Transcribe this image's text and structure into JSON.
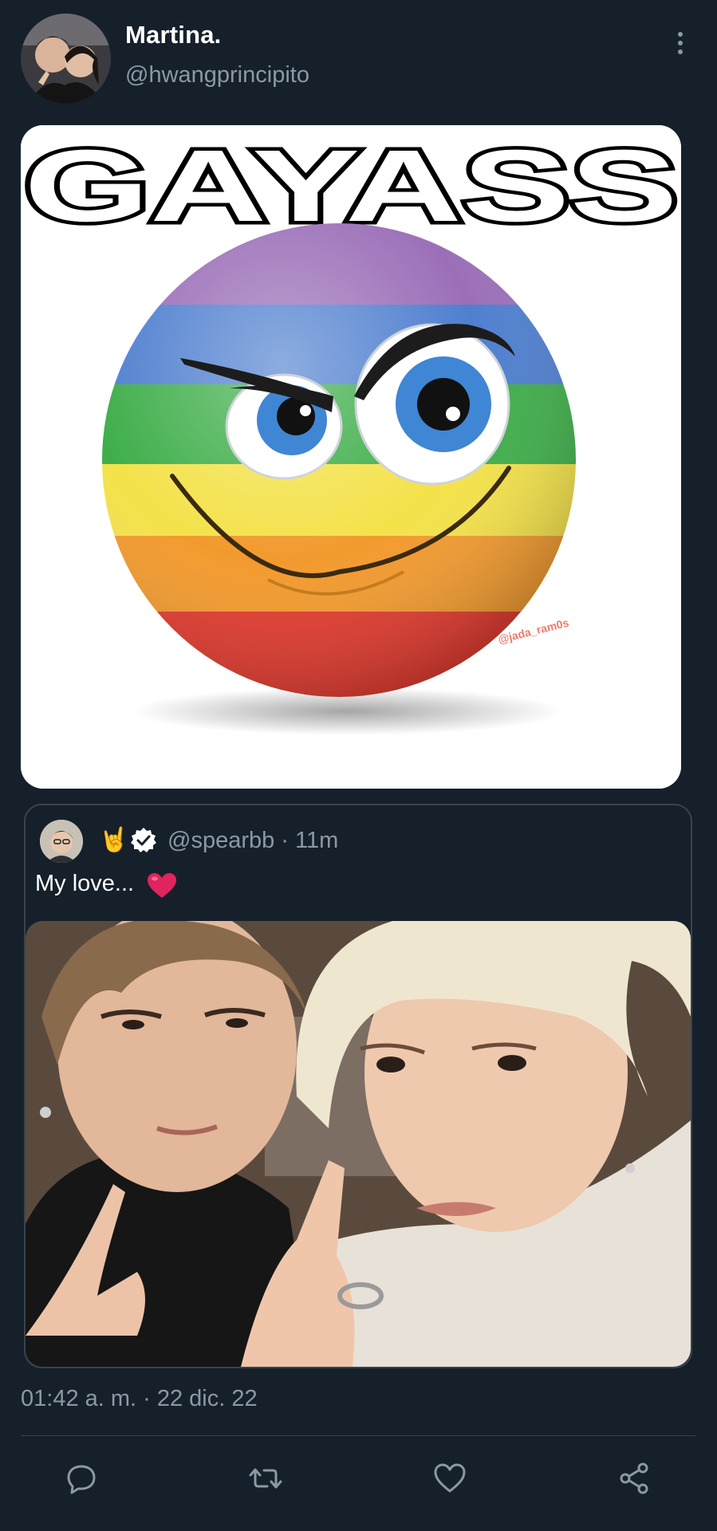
{
  "author": {
    "display_name": "Martina.",
    "handle": "@hwangprincipito",
    "avatar_icon": "avatar-photo"
  },
  "more_icon": "more-vertical-icon",
  "media_main": {
    "caption_text": "GAYASS",
    "watermark": "@jada_ram0s"
  },
  "quote": {
    "emoji": "🤘",
    "handle": "@spearbb · 11m",
    "text": "My love...",
    "verified_icon": "verified-badge-icon",
    "heart_icon": "red-heart-icon"
  },
  "timestamp": "01:42 a. m. · 22 dic. 22",
  "actions": [
    {
      "name": "reply",
      "icon": "reply-icon"
    },
    {
      "name": "retweet",
      "icon": "retweet-icon"
    },
    {
      "name": "like",
      "icon": "like-icon"
    },
    {
      "name": "share",
      "icon": "share-icon"
    }
  ],
  "colors": {
    "background": "#15202b",
    "secondary_text": "#8b98a5",
    "border": "#38444d",
    "heart": "#e0245e"
  }
}
